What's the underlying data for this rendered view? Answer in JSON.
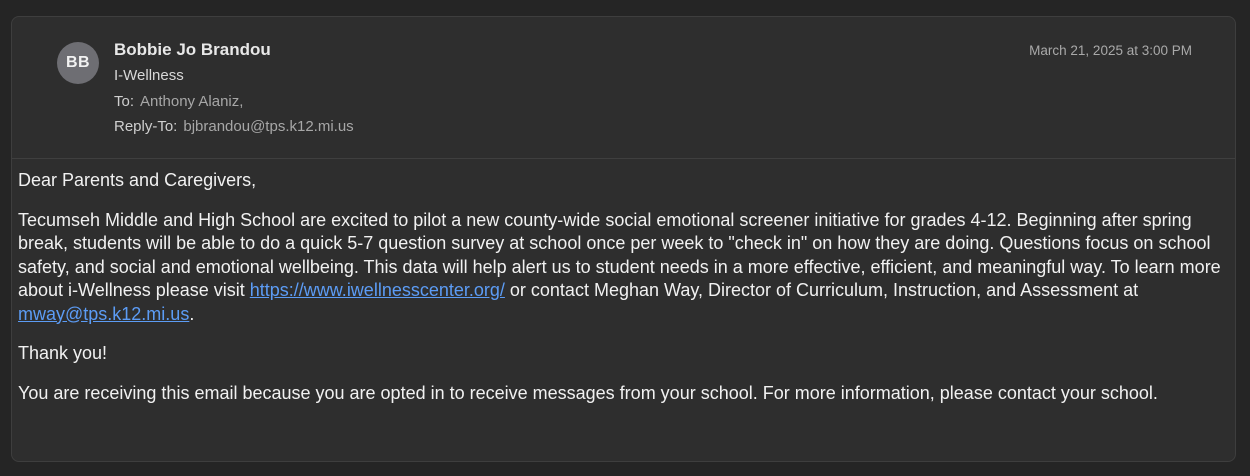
{
  "sender": {
    "initials": "BB",
    "name": "Bobbie Jo Brandou"
  },
  "subject": "I-Wellness",
  "date": "March 21, 2025 at 3:00 PM",
  "to": {
    "label": "To:",
    "value": "Anthony Alaniz,"
  },
  "reply_to": {
    "label": "Reply-To:",
    "value": "bjbrandou@tps.k12.mi.us"
  },
  "body": {
    "greeting": "Dear Parents and Caregivers,",
    "para_text_1": "Tecumseh Middle and High School are excited to pilot a new county-wide social emotional screener initiative for grades 4-12.  Beginning after spring break, students will be able to do a quick 5-7 question survey at school once per week to \"check in\" on how they are doing. Questions focus on school safety, and social and emotional wellbeing. This data will help alert us to student needs in a more effective, efficient, and meaningful way.  To learn more about i-Wellness please visit ",
    "link_website": "https://www.iwellnesscenter.org/",
    "para_text_2": " or contact Meghan Way, Director of Curriculum, Instruction, and Assessment at ",
    "link_email": "mway@tps.k12.mi.us",
    "para_text_3": ".",
    "thanks": "Thank you!",
    "footer": "You are receiving this email because you are opted in to receive messages from your school. For more information, please contact your school."
  }
}
